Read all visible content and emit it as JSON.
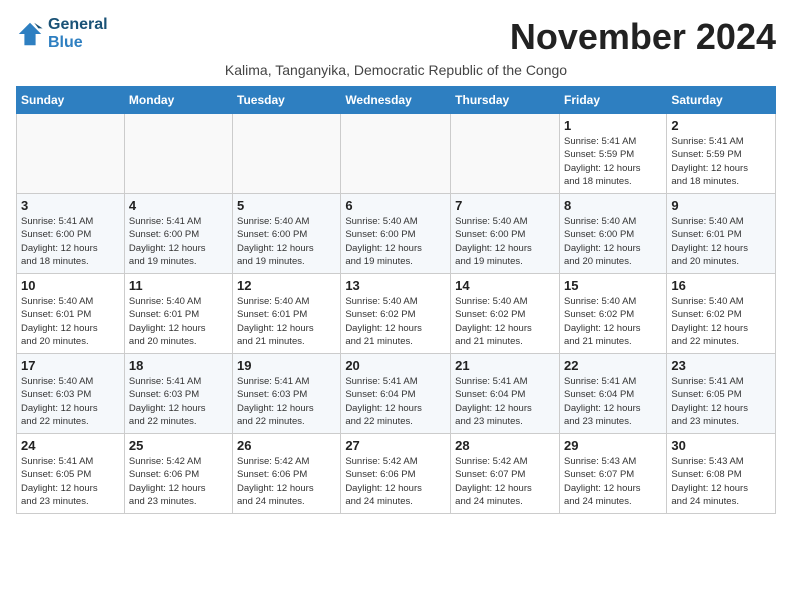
{
  "logo": {
    "line1": "General",
    "line2": "Blue"
  },
  "title": "November 2024",
  "subtitle": "Kalima, Tanganyika, Democratic Republic of the Congo",
  "headers": [
    "Sunday",
    "Monday",
    "Tuesday",
    "Wednesday",
    "Thursday",
    "Friday",
    "Saturday"
  ],
  "weeks": [
    [
      {
        "day": "",
        "info": ""
      },
      {
        "day": "",
        "info": ""
      },
      {
        "day": "",
        "info": ""
      },
      {
        "day": "",
        "info": ""
      },
      {
        "day": "",
        "info": ""
      },
      {
        "day": "1",
        "info": "Sunrise: 5:41 AM\nSunset: 5:59 PM\nDaylight: 12 hours\nand 18 minutes."
      },
      {
        "day": "2",
        "info": "Sunrise: 5:41 AM\nSunset: 5:59 PM\nDaylight: 12 hours\nand 18 minutes."
      }
    ],
    [
      {
        "day": "3",
        "info": "Sunrise: 5:41 AM\nSunset: 6:00 PM\nDaylight: 12 hours\nand 18 minutes."
      },
      {
        "day": "4",
        "info": "Sunrise: 5:41 AM\nSunset: 6:00 PM\nDaylight: 12 hours\nand 19 minutes."
      },
      {
        "day": "5",
        "info": "Sunrise: 5:40 AM\nSunset: 6:00 PM\nDaylight: 12 hours\nand 19 minutes."
      },
      {
        "day": "6",
        "info": "Sunrise: 5:40 AM\nSunset: 6:00 PM\nDaylight: 12 hours\nand 19 minutes."
      },
      {
        "day": "7",
        "info": "Sunrise: 5:40 AM\nSunset: 6:00 PM\nDaylight: 12 hours\nand 19 minutes."
      },
      {
        "day": "8",
        "info": "Sunrise: 5:40 AM\nSunset: 6:00 PM\nDaylight: 12 hours\nand 20 minutes."
      },
      {
        "day": "9",
        "info": "Sunrise: 5:40 AM\nSunset: 6:01 PM\nDaylight: 12 hours\nand 20 minutes."
      }
    ],
    [
      {
        "day": "10",
        "info": "Sunrise: 5:40 AM\nSunset: 6:01 PM\nDaylight: 12 hours\nand 20 minutes."
      },
      {
        "day": "11",
        "info": "Sunrise: 5:40 AM\nSunset: 6:01 PM\nDaylight: 12 hours\nand 20 minutes."
      },
      {
        "day": "12",
        "info": "Sunrise: 5:40 AM\nSunset: 6:01 PM\nDaylight: 12 hours\nand 21 minutes."
      },
      {
        "day": "13",
        "info": "Sunrise: 5:40 AM\nSunset: 6:02 PM\nDaylight: 12 hours\nand 21 minutes."
      },
      {
        "day": "14",
        "info": "Sunrise: 5:40 AM\nSunset: 6:02 PM\nDaylight: 12 hours\nand 21 minutes."
      },
      {
        "day": "15",
        "info": "Sunrise: 5:40 AM\nSunset: 6:02 PM\nDaylight: 12 hours\nand 21 minutes."
      },
      {
        "day": "16",
        "info": "Sunrise: 5:40 AM\nSunset: 6:02 PM\nDaylight: 12 hours\nand 22 minutes."
      }
    ],
    [
      {
        "day": "17",
        "info": "Sunrise: 5:40 AM\nSunset: 6:03 PM\nDaylight: 12 hours\nand 22 minutes."
      },
      {
        "day": "18",
        "info": "Sunrise: 5:41 AM\nSunset: 6:03 PM\nDaylight: 12 hours\nand 22 minutes."
      },
      {
        "day": "19",
        "info": "Sunrise: 5:41 AM\nSunset: 6:03 PM\nDaylight: 12 hours\nand 22 minutes."
      },
      {
        "day": "20",
        "info": "Sunrise: 5:41 AM\nSunset: 6:04 PM\nDaylight: 12 hours\nand 22 minutes."
      },
      {
        "day": "21",
        "info": "Sunrise: 5:41 AM\nSunset: 6:04 PM\nDaylight: 12 hours\nand 23 minutes."
      },
      {
        "day": "22",
        "info": "Sunrise: 5:41 AM\nSunset: 6:04 PM\nDaylight: 12 hours\nand 23 minutes."
      },
      {
        "day": "23",
        "info": "Sunrise: 5:41 AM\nSunset: 6:05 PM\nDaylight: 12 hours\nand 23 minutes."
      }
    ],
    [
      {
        "day": "24",
        "info": "Sunrise: 5:41 AM\nSunset: 6:05 PM\nDaylight: 12 hours\nand 23 minutes."
      },
      {
        "day": "25",
        "info": "Sunrise: 5:42 AM\nSunset: 6:06 PM\nDaylight: 12 hours\nand 23 minutes."
      },
      {
        "day": "26",
        "info": "Sunrise: 5:42 AM\nSunset: 6:06 PM\nDaylight: 12 hours\nand 24 minutes."
      },
      {
        "day": "27",
        "info": "Sunrise: 5:42 AM\nSunset: 6:06 PM\nDaylight: 12 hours\nand 24 minutes."
      },
      {
        "day": "28",
        "info": "Sunrise: 5:42 AM\nSunset: 6:07 PM\nDaylight: 12 hours\nand 24 minutes."
      },
      {
        "day": "29",
        "info": "Sunrise: 5:43 AM\nSunset: 6:07 PM\nDaylight: 12 hours\nand 24 minutes."
      },
      {
        "day": "30",
        "info": "Sunrise: 5:43 AM\nSunset: 6:08 PM\nDaylight: 12 hours\nand 24 minutes."
      }
    ]
  ]
}
